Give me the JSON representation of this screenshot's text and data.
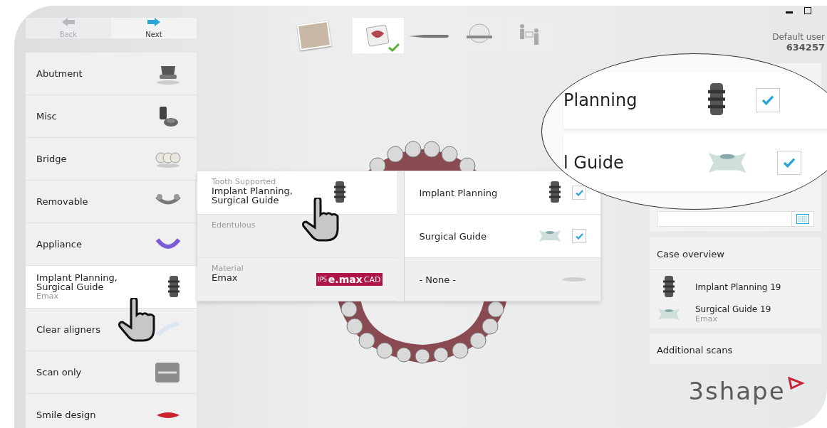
{
  "window_controls": [
    {
      "kind": "minimize"
    },
    {
      "kind": "maximize"
    }
  ],
  "nav": {
    "back": {
      "label": "Back",
      "disabled": true
    },
    "next": {
      "label": "Next",
      "disabled": false
    }
  },
  "steps": [
    {
      "kind": "patient",
      "selected": false,
      "done": false
    },
    {
      "kind": "order",
      "selected": true,
      "done": true
    },
    {
      "kind": "scan",
      "selected": false,
      "done": false
    },
    {
      "kind": "bite",
      "selected": false,
      "done": false
    },
    {
      "kind": "send",
      "selected": false,
      "done": false
    }
  ],
  "user": {
    "name": "Default user",
    "id": "634257"
  },
  "indications": [
    {
      "label": "Abutment",
      "kind": "abutment",
      "selected": false
    },
    {
      "label": "Misc",
      "kind": "misc",
      "selected": false
    },
    {
      "label": "Bridge",
      "kind": "bridge",
      "selected": false
    },
    {
      "label": "Removable",
      "kind": "removable",
      "selected": false
    },
    {
      "label": "Appliance",
      "kind": "appliance",
      "selected": false
    },
    {
      "label": "Implant Planning, Surgical Guide",
      "sublabel": "Emax",
      "kind": "implant",
      "selected": true
    },
    {
      "label": "Clear aligners",
      "kind": "aligner",
      "selected": false
    },
    {
      "label": "Scan only",
      "kind": "model",
      "selected": false
    },
    {
      "label": "Smile design",
      "kind": "smile",
      "selected": false
    }
  ],
  "options": [
    {
      "caption": "Tooth Supported",
      "label": "Implant Planning, Surgical Guide",
      "kind": "implant",
      "selected": true
    },
    {
      "caption": "Edentulous",
      "kind": "none",
      "selected": false
    },
    {
      "caption": "Material",
      "label": "Emax",
      "kind": "emax",
      "selected": false
    }
  ],
  "material_logo": {
    "prefix": "IPS",
    "main": "e.max",
    "suffix": "CAD"
  },
  "types": [
    {
      "label": "Implant Planning",
      "kind": "implant",
      "checked": true
    },
    {
      "label": "Surgical Guide",
      "kind": "guide",
      "checked": true
    },
    {
      "label": "- None -",
      "kind": "none"
    }
  ],
  "magnifier": [
    {
      "label": "Planning",
      "kind": "implant",
      "checked": true
    },
    {
      "label": "l Guide",
      "kind": "guide",
      "checked": true
    }
  ],
  "case_overview": {
    "title": "Case overview",
    "items": [
      {
        "label": "Implant Planning 19",
        "kind": "implant"
      },
      {
        "label": "Surgical Guide 19",
        "sublabel": "Emax",
        "kind": "guide"
      }
    ]
  },
  "additional_scans": {
    "title": "Additional scans"
  },
  "logo": {
    "text": "3shape"
  }
}
